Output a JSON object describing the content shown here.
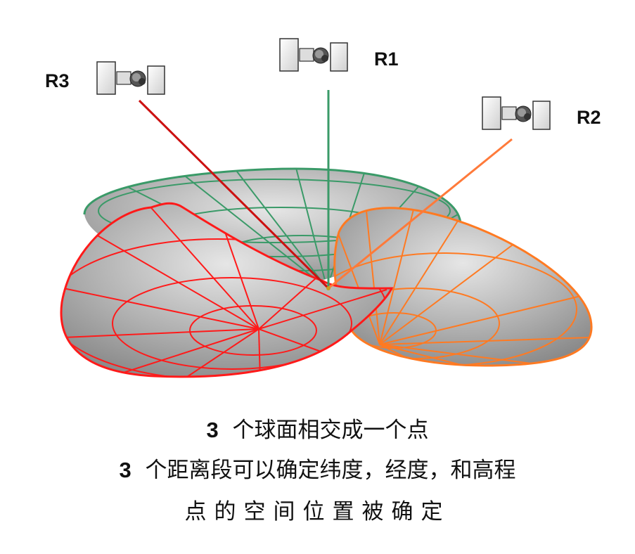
{
  "satellites": [
    {
      "id": "R1",
      "label": "R1"
    },
    {
      "id": "R2",
      "label": "R2"
    },
    {
      "id": "R3",
      "label": "R3"
    }
  ],
  "colors": {
    "green": "#3a9a68",
    "orange": "#ff7a22",
    "red": "#ff1a1a",
    "ray_red": "#cc1111",
    "surface_light": "#dcdcdc",
    "surface_dark": "#8a8a8a"
  },
  "captions": {
    "line1_num": "3",
    "line1_text": "个球面相交成一个点",
    "line2_num": "3",
    "line2_text": "个距离段可以确定纬度，经度，和高程",
    "line3_text": "点的空间位置被确定"
  }
}
